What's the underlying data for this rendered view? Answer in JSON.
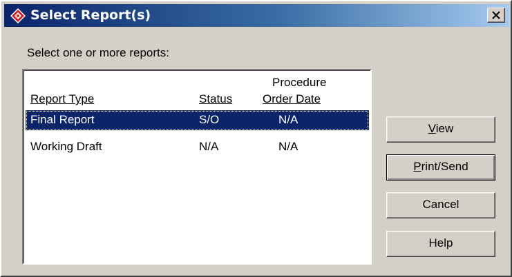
{
  "window": {
    "title": "Select Report(s)",
    "icon": "diamond-app-icon",
    "close_icon": "close-icon"
  },
  "prompt": "Select one or more reports:",
  "list": {
    "columns": {
      "report_type": "Report Type",
      "status": "Status",
      "procedure_line1": "Procedure",
      "procedure_line2": "Order Date"
    },
    "rows": [
      {
        "report_type": "Final Report",
        "status": "S/O",
        "order_date": "N/A",
        "selected": true
      },
      {
        "report_type": "Working Draft",
        "status": "N/A",
        "order_date": "N/A",
        "selected": false
      }
    ]
  },
  "buttons": {
    "view": {
      "mnemonic": "V",
      "rest": "iew"
    },
    "print": {
      "mnemonic": "P",
      "rest": "rint/Send"
    },
    "cancel": "Cancel",
    "help": "Help"
  },
  "colors": {
    "title_gradient_start": "#0a246a",
    "title_gradient_end": "#a6caf0",
    "selection": "#0a246a",
    "face": "#d4d0c8"
  }
}
